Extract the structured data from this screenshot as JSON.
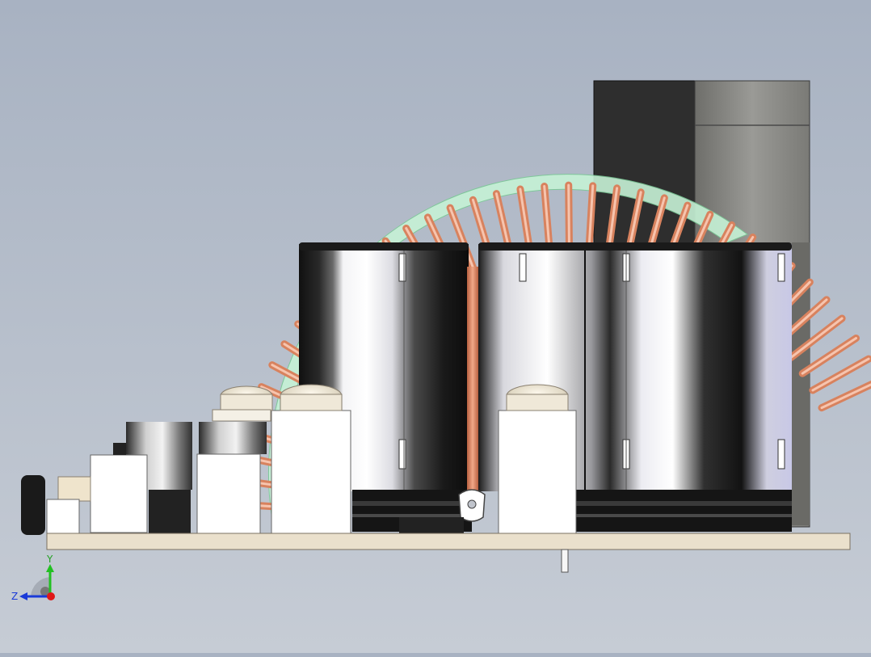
{
  "triad": {
    "y_label": "Y",
    "z_label": "Z"
  },
  "colors": {
    "background_top": "#a8b2c2",
    "background_bottom": "#c6ccd5",
    "pcb": "#e8dcc8",
    "copper": "#d8825e",
    "core": "#b8ecc8",
    "capacitor_dark": "#1a1a1a",
    "capacitor_sleeve_light": "#e6e6ec",
    "heatsink": "#8e8e8a",
    "axis_y": "#22c022",
    "axis_z": "#1a3ad8",
    "axis_x": "#e01818"
  },
  "scene": {
    "capacitor_count": 3,
    "toroid_turns_visible": 38
  }
}
